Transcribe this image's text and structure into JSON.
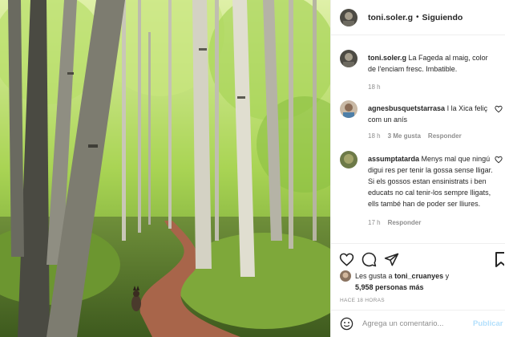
{
  "post": {
    "author": "toni.soler.g",
    "follow_status": "Siguiendo",
    "separator": "•",
    "caption": "La Fageda al maig, color de l'enciam fresc. Imbatible.",
    "caption_time": "18 h",
    "image_alt": "Forest path with beech trees and a dog"
  },
  "comments": [
    {
      "user": "agnesbusquetstarrasa",
      "text": "I la Xica feliç com un anís",
      "time": "18 h",
      "likes": "3 Me gusta",
      "reply": "Responder"
    },
    {
      "user": "assumptatarda",
      "text": "Menys mal que ningú digui res per tenir la gossa sense lligar. Si els gossos estan ensinistrats i ben educats no cal tenir-los sempre lligats, ells també han de poder ser lliures.",
      "time": "17 h",
      "reply": "Responder"
    }
  ],
  "likes": {
    "prefix": "Les gusta a",
    "user": "toni_cruanyes",
    "conj": "y",
    "count": "5,958 personas más"
  },
  "time_ago": "HACE 18 HORAS",
  "composer": {
    "placeholder": "Agrega un comentario...",
    "publish": "Publicar"
  },
  "icons": {
    "like": "heart-icon",
    "comment": "comment-icon",
    "share": "share-icon",
    "save": "bookmark-icon",
    "emoji": "emoji-icon"
  },
  "colors": {
    "accent_publish": "#b2dffc",
    "muted": "#8e8e8e",
    "text": "#262626"
  }
}
